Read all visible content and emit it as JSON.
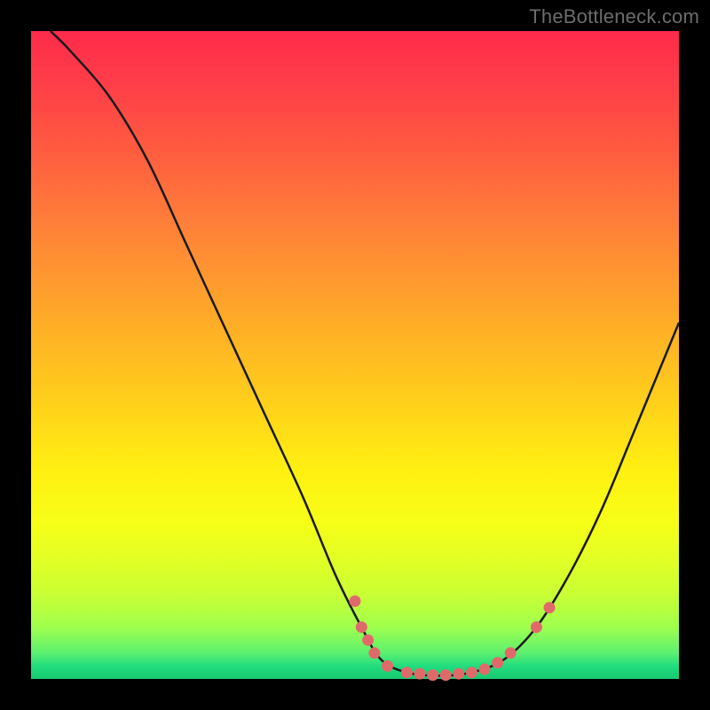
{
  "watermark": "TheBottleneck.com",
  "chart_data": {
    "type": "line",
    "title": "",
    "xlabel": "",
    "ylabel": "",
    "xlim": [
      0,
      100
    ],
    "ylim": [
      0,
      100
    ],
    "curve": [
      {
        "x": 3,
        "y": 100
      },
      {
        "x": 6,
        "y": 97
      },
      {
        "x": 12,
        "y": 90
      },
      {
        "x": 18,
        "y": 80
      },
      {
        "x": 24,
        "y": 67
      },
      {
        "x": 30,
        "y": 54
      },
      {
        "x": 36,
        "y": 41
      },
      {
        "x": 42,
        "y": 28
      },
      {
        "x": 47,
        "y": 16
      },
      {
        "x": 51,
        "y": 8
      },
      {
        "x": 54,
        "y": 3
      },
      {
        "x": 58,
        "y": 1
      },
      {
        "x": 63,
        "y": 0.5
      },
      {
        "x": 68,
        "y": 1
      },
      {
        "x": 73,
        "y": 3
      },
      {
        "x": 78,
        "y": 8
      },
      {
        "x": 83,
        "y": 16
      },
      {
        "x": 88,
        "y": 26
      },
      {
        "x": 93,
        "y": 38
      },
      {
        "x": 100,
        "y": 55
      }
    ],
    "points": [
      {
        "x": 50,
        "y": 12
      },
      {
        "x": 51,
        "y": 8
      },
      {
        "x": 52,
        "y": 6
      },
      {
        "x": 53,
        "y": 4
      },
      {
        "x": 55,
        "y": 2
      },
      {
        "x": 58,
        "y": 1
      },
      {
        "x": 60,
        "y": 0.8
      },
      {
        "x": 62,
        "y": 0.6
      },
      {
        "x": 64,
        "y": 0.6
      },
      {
        "x": 66,
        "y": 0.8
      },
      {
        "x": 68,
        "y": 1
      },
      {
        "x": 70,
        "y": 1.5
      },
      {
        "x": 72,
        "y": 2.5
      },
      {
        "x": 74,
        "y": 4
      },
      {
        "x": 78,
        "y": 8
      },
      {
        "x": 80,
        "y": 11
      }
    ]
  },
  "colors": {
    "dot": "#e06a6a",
    "curve": "#1a1a1a"
  }
}
